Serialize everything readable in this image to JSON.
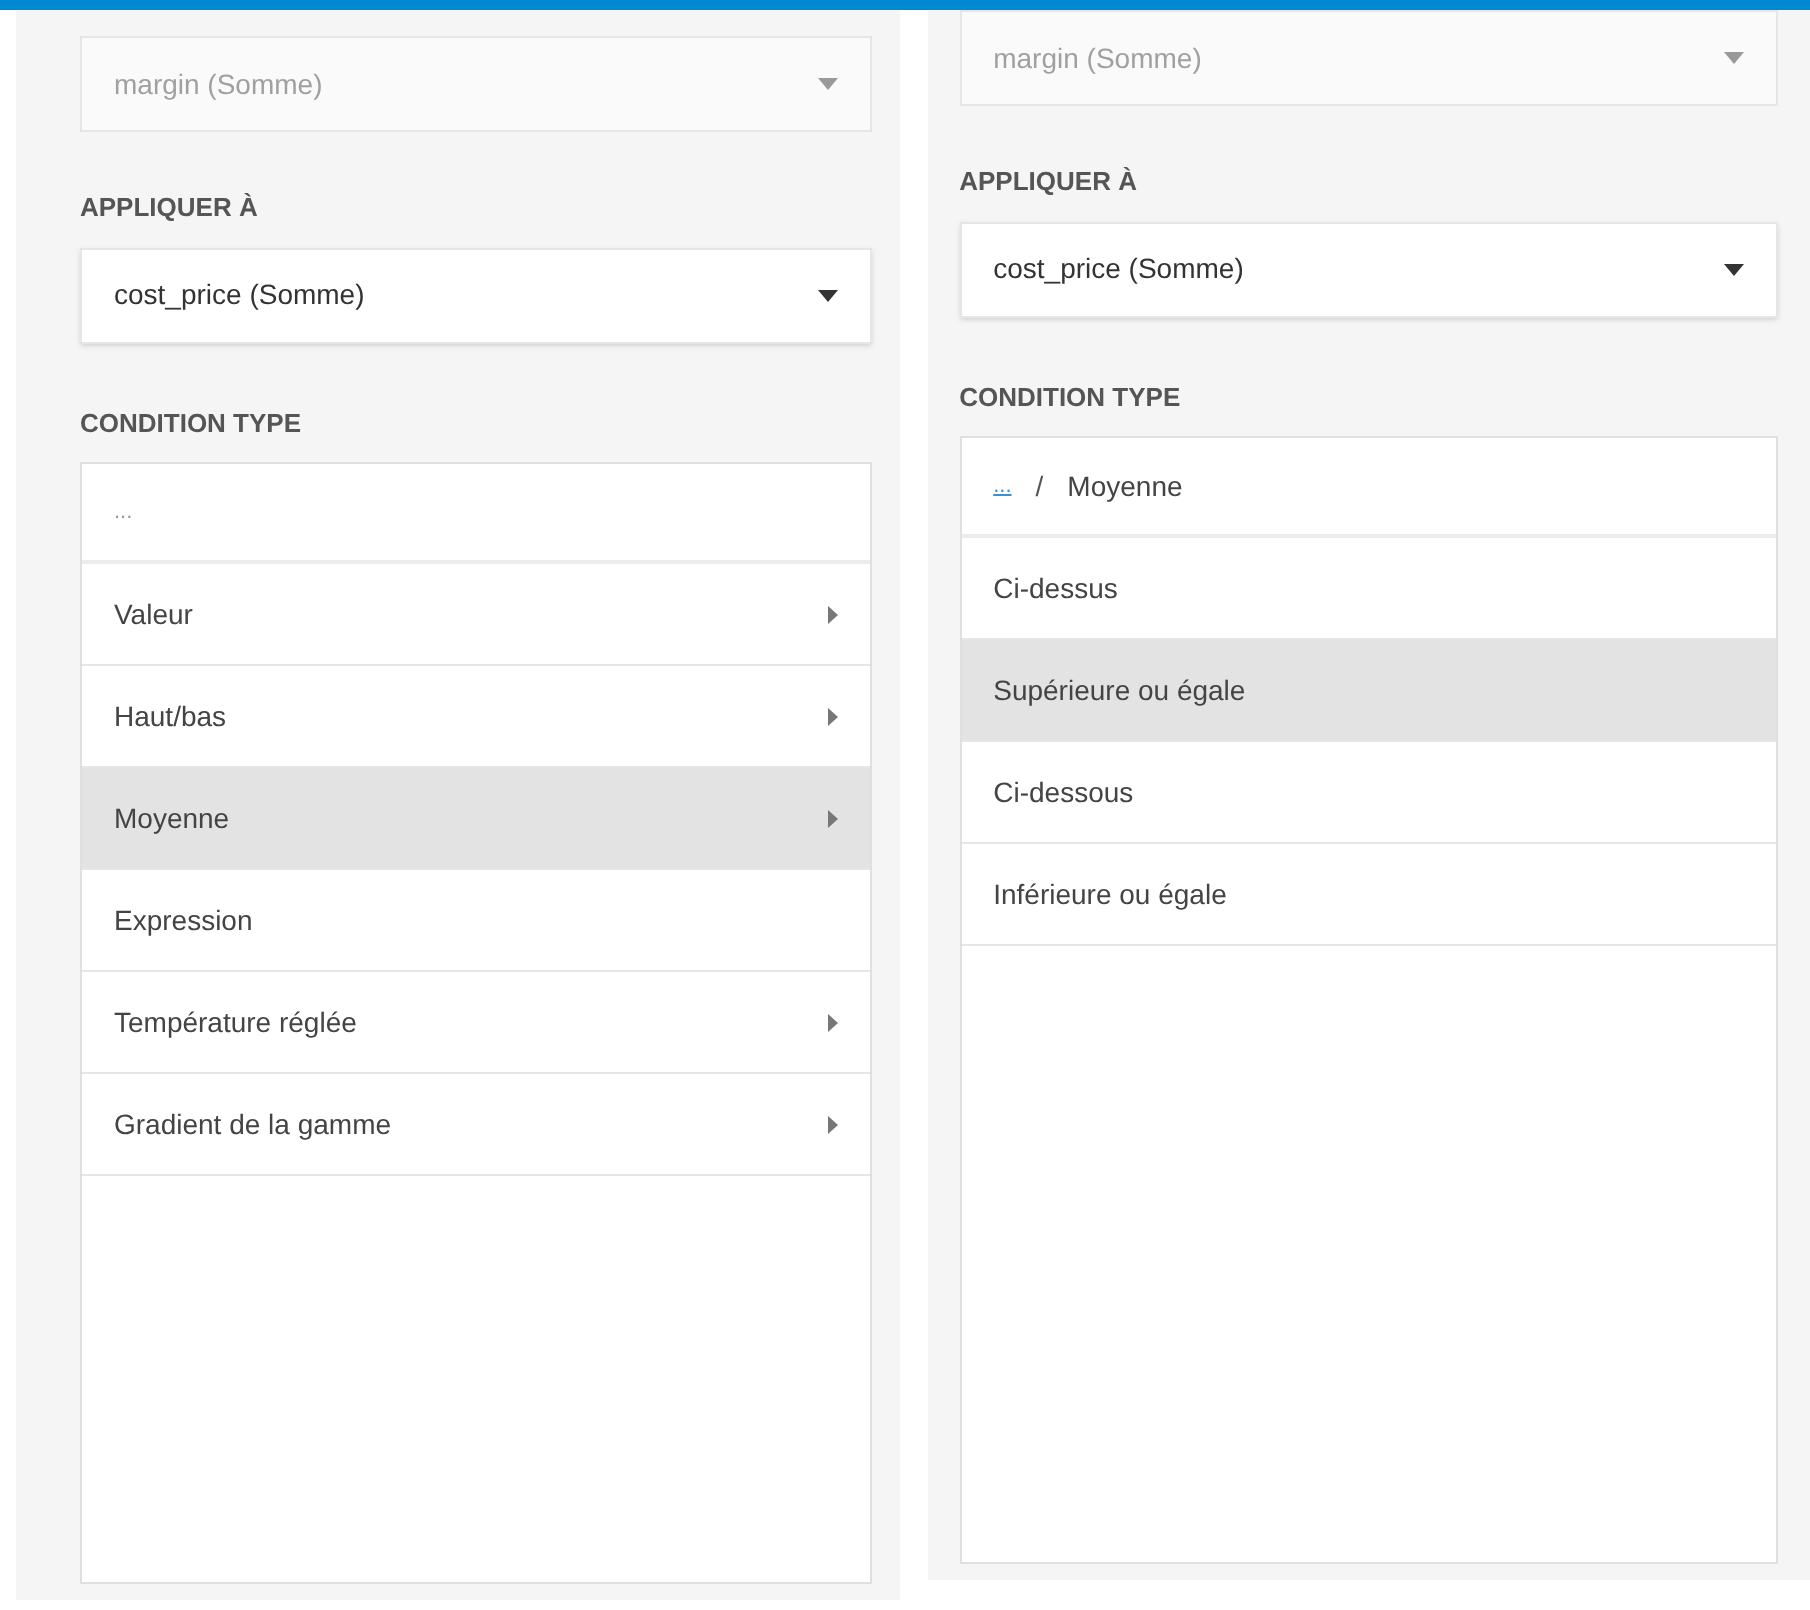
{
  "panels": [
    {
      "based_on": {
        "value": "margin (Somme)",
        "disabled": true
      },
      "apply_label": "APPLIQUER À",
      "apply_to": {
        "value": "cost_price (Somme)",
        "disabled": false
      },
      "condition_label": "CONDITION TYPE",
      "list_header": {
        "current": "..."
      },
      "items": [
        {
          "label": "Valeur",
          "submenu": true,
          "selected": false
        },
        {
          "label": "Haut/bas",
          "submenu": true,
          "selected": false
        },
        {
          "label": "Moyenne",
          "submenu": true,
          "selected": true
        },
        {
          "label": "Expression",
          "submenu": false,
          "selected": false
        },
        {
          "label": "Température réglée",
          "submenu": true,
          "selected": false
        },
        {
          "label": "Gradient de la gamme",
          "submenu": true,
          "selected": false
        }
      ]
    },
    {
      "based_on": {
        "value": "margin (Somme)",
        "disabled": true
      },
      "apply_label": "APPLIQUER À",
      "apply_to": {
        "value": "cost_price (Somme)",
        "disabled": false
      },
      "condition_label": "CONDITION TYPE",
      "list_header": {
        "link": "...",
        "separator": "/",
        "current": "Moyenne"
      },
      "items": [
        {
          "label": "Ci-dessus",
          "submenu": false,
          "selected": false
        },
        {
          "label": "Supérieure ou égale",
          "submenu": false,
          "selected": true
        },
        {
          "label": "Ci-dessous",
          "submenu": false,
          "selected": false
        },
        {
          "label": "Inférieure ou égale",
          "submenu": false,
          "selected": false
        }
      ]
    }
  ]
}
